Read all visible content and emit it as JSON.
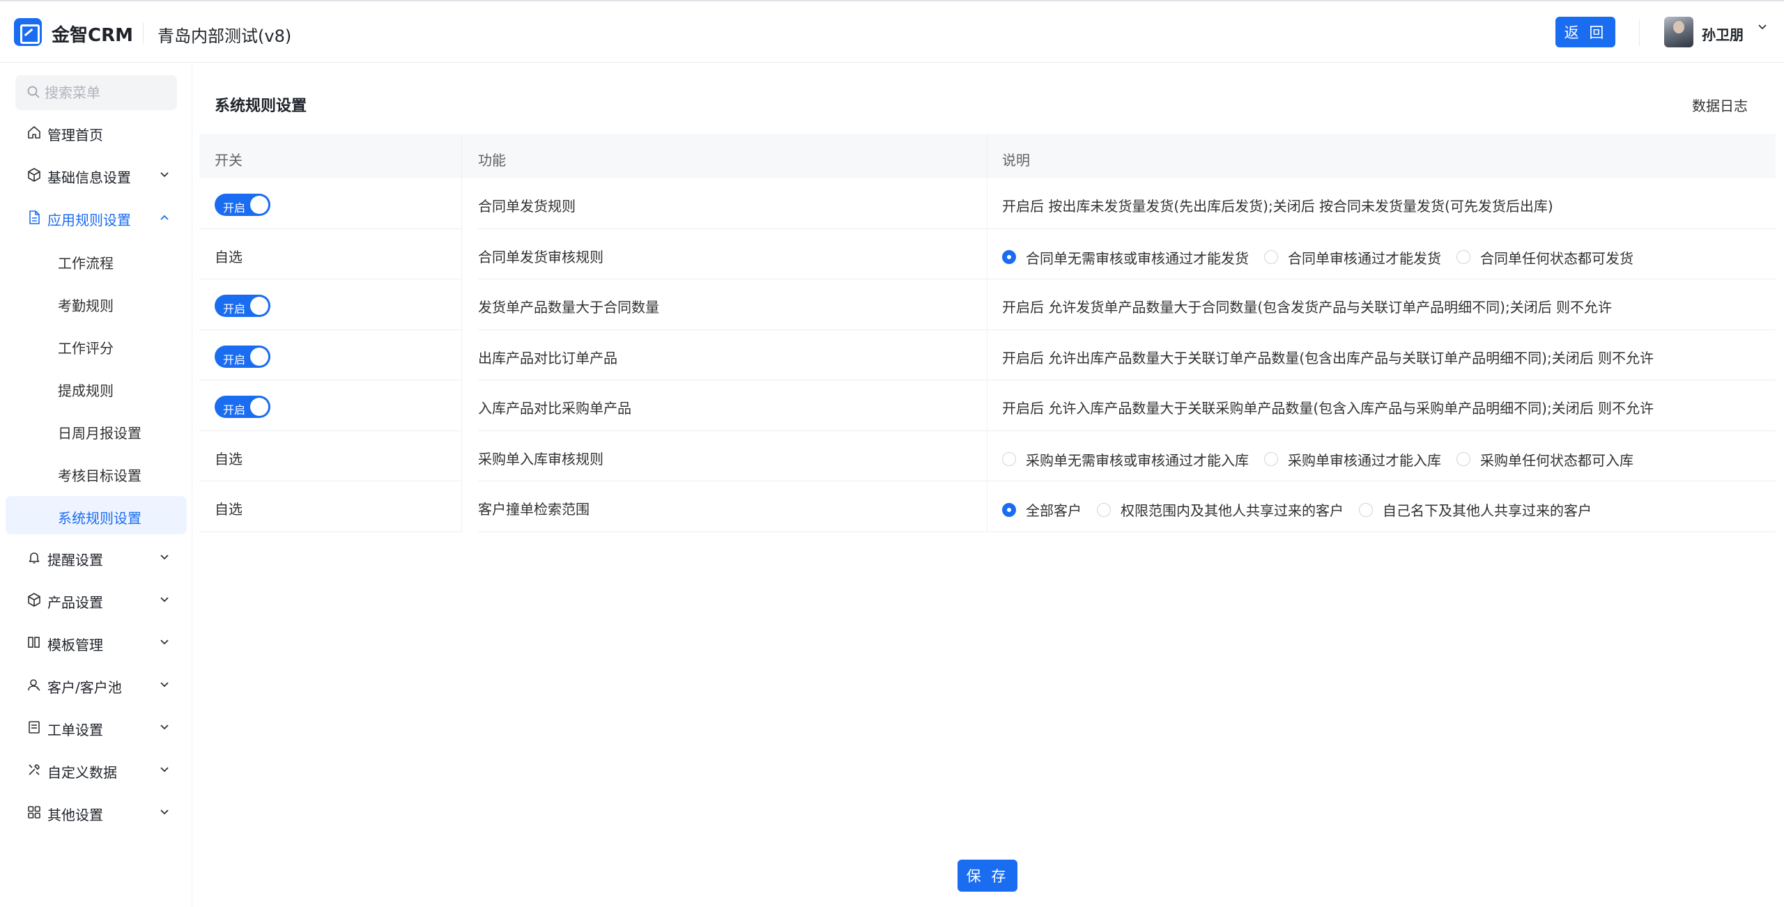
{
  "header": {
    "brand": "金智CRM",
    "company": "青岛内部测试(v8)",
    "back_label": "返 回",
    "user_name": "孙卫朋"
  },
  "sidebar": {
    "search_placeholder": "搜索菜单",
    "items": [
      {
        "label": "管理首页",
        "icon": "home-icon"
      },
      {
        "label": "基础信息设置",
        "icon": "cube-icon"
      },
      {
        "label": "应用规则设置",
        "icon": "document-icon"
      },
      {
        "label": "提醒设置",
        "icon": "bell-icon"
      },
      {
        "label": "产品设置",
        "icon": "cube-icon"
      },
      {
        "label": "模板管理",
        "icon": "template-icon"
      },
      {
        "label": "客户/客户池",
        "icon": "user-icon"
      },
      {
        "label": "工单设置",
        "icon": "ticket-icon"
      },
      {
        "label": "自定义数据",
        "icon": "tools-icon"
      },
      {
        "label": "其他设置",
        "icon": "grid-icon"
      }
    ],
    "sub_items": [
      "工作流程",
      "考勤规则",
      "工作评分",
      "提成规则",
      "日周月报设置",
      "考核目标设置",
      "系统规则设置"
    ]
  },
  "main": {
    "title": "系统规则设置",
    "data_log": "数据日志",
    "columns": [
      "开关",
      "功能",
      "说明"
    ],
    "toggle_label": "开启",
    "custom_label": "自选",
    "rows": [
      {
        "func": "合同单发货规则",
        "desc": "开启后 按出库未发货量发货(先出库后发货);关闭后 按合同未发货量发货(可先发货后出库)"
      },
      {
        "func": "合同单发货审核规则",
        "options": [
          "合同单无需审核或审核通过才能发货",
          "合同单审核通过才能发货",
          "合同单任何状态都可发货"
        ]
      },
      {
        "func": "发货单产品数量大于合同数量",
        "desc": "开启后 允许发货单产品数量大于合同数量(包含发货产品与关联订单产品明细不同);关闭后 则不允许"
      },
      {
        "func": "出库产品对比订单产品",
        "desc": "开启后 允许出库产品数量大于关联订单产品数量(包含出库产品与关联订单产品明细不同);关闭后 则不允许"
      },
      {
        "func": "入库产品对比采购单产品",
        "desc": "开启后 允许入库产品数量大于关联采购单产品数量(包含入库产品与采购单产品明细不同);关闭后 则不允许"
      },
      {
        "func": "采购单入库审核规则",
        "options": [
          "采购单无需审核或审核通过才能入库",
          "采购单审核通过才能入库",
          "采购单任何状态都可入库"
        ]
      },
      {
        "func": "客户撞单检索范围",
        "options": [
          "全部客户",
          "权限范围内及其他人共享过来的客户",
          "自己名下及其他人共享过来的客户"
        ]
      }
    ],
    "save_label": "保 存"
  },
  "colors": {
    "accent": "#1a6cf0",
    "selected_bg": "#eef4ff"
  }
}
